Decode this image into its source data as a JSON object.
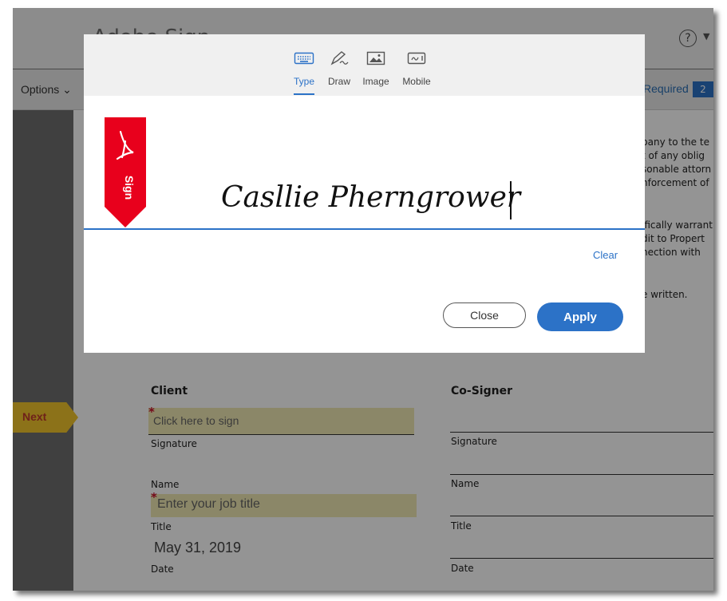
{
  "app": {
    "title": "Adobe Sign"
  },
  "toolbar": {
    "options_label": "Options ⌄",
    "required_label": "Required",
    "required_count": "2"
  },
  "document": {
    "right_text_lines": [
      "pany to the te",
      "t of any oblig",
      "sonable attorn",
      "nforcement of",
      "ifically warrant",
      "dit to Propert",
      "nection with",
      "e written."
    ],
    "client": {
      "heading": "Client",
      "sign_placeholder": "Click here to sign",
      "signature_label": "Signature",
      "name_label": "Name",
      "job_title_placeholder": "Enter your job title",
      "title_label": "Title",
      "date_value": "May 31, 2019",
      "date_label": "Date"
    },
    "cosigner": {
      "heading": "Co-Signer",
      "signature_label": "Signature",
      "name_label": "Name",
      "title_label": "Title",
      "date_label": "Date"
    },
    "next_label": "Next"
  },
  "dialog": {
    "tabs": [
      {
        "label": "Type",
        "icon": "keyboard-icon",
        "active": true
      },
      {
        "label": "Draw",
        "icon": "pen-icon",
        "active": false
      },
      {
        "label": "Image",
        "icon": "image-icon",
        "active": false
      },
      {
        "label": "Mobile",
        "icon": "mobile-icon",
        "active": false
      }
    ],
    "ribbon_label": "Sign",
    "signature_value": "Casllie Pherngrower",
    "clear_label": "Clear",
    "close_label": "Close",
    "apply_label": "Apply"
  },
  "colors": {
    "accent": "#2c72c7",
    "adobe_red": "#e8001c",
    "field_yellow": "#f0e9b3",
    "next_tag": "#f2c42c"
  }
}
